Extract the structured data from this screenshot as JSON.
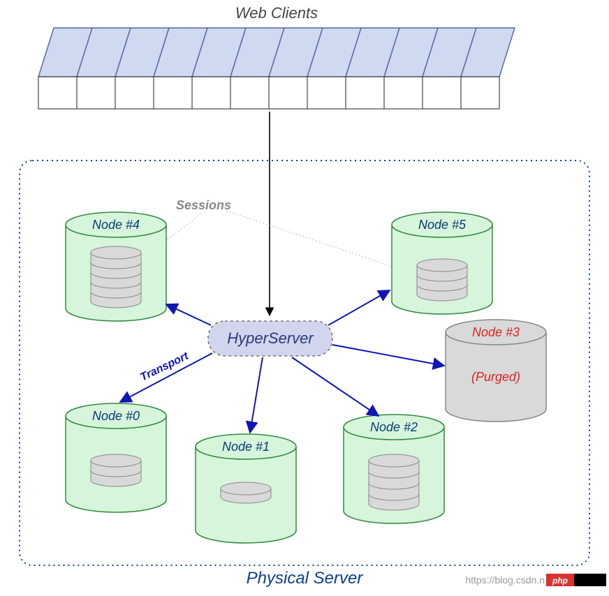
{
  "title": "Web Clients",
  "clients": {
    "count": 12
  },
  "container": {
    "label": "Physical Server"
  },
  "hub": {
    "label": "HyperServer"
  },
  "labels": {
    "sessions": "Sessions",
    "transport": "Transport"
  },
  "nodes": [
    {
      "id": "node0",
      "label": "Node #0",
      "purged": false
    },
    {
      "id": "node1",
      "label": "Node #1",
      "purged": false
    },
    {
      "id": "node2",
      "label": "Node #2",
      "purged": false
    },
    {
      "id": "node3",
      "label": "Node #3",
      "purged": true,
      "status": "(Purged)"
    },
    {
      "id": "node4",
      "label": "Node #4",
      "purged": false
    },
    {
      "id": "node5",
      "label": "Node #5",
      "purged": false
    }
  ],
  "watermark": "https://blog.csdn.n",
  "badge": "php",
  "colors": {
    "client_fill": "#cfd9ef",
    "client_stroke": "#5a6aa5",
    "node_fill": "#d7f5da",
    "node_stroke": "#2f8a3f",
    "purged_fill": "#d9d9d9",
    "purged_stroke": "#888",
    "hub_fill": "#d2d5ee",
    "hub_stroke": "#777",
    "frame_stroke": "#0b3e8f",
    "arrow_blue": "#1015b5",
    "disk_fill": "#d9d9d9",
    "disk_stroke": "#888"
  }
}
